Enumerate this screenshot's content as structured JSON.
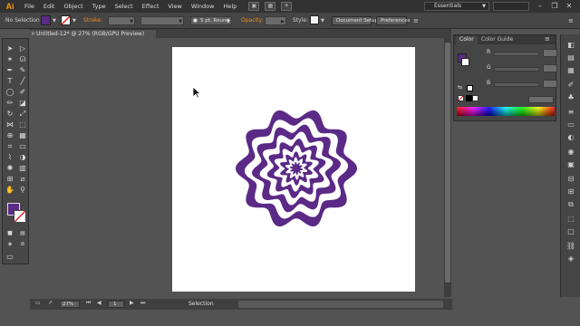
{
  "app": {
    "logo": "Ai",
    "workspace": "Essentials"
  },
  "menu": [
    "File",
    "Edit",
    "Object",
    "Type",
    "Select",
    "Effect",
    "View",
    "Window",
    "Help"
  ],
  "menu_icons": [
    "bridge-icon",
    "arrange-documents-icon",
    "gpu-icon"
  ],
  "control_bar": {
    "selection_label": "No Selection",
    "stroke_label": "Stroke:",
    "brush_label": "5 pt. Round",
    "opacity_label": "Opacity:",
    "style_label": "Style:",
    "document_setup": "Document Setup",
    "preferences": "Preferences",
    "fill_color": "#5b2a86"
  },
  "document": {
    "tab_title": "Untitled-12* @ 27% (RGB/GPU Preview)",
    "close": "×"
  },
  "canvas": {
    "artwork": "wavy-concentric-flower",
    "art_color": "#5b2a86"
  },
  "status": {
    "zoom": "27%",
    "artboard_number": "1",
    "tool": "Selection"
  },
  "color_panel": {
    "tabs": [
      "Color",
      "Color Guide"
    ],
    "channels": [
      "R",
      "G",
      "B"
    ],
    "fill_color": "#5b2a86"
  },
  "window_buttons": [
    "–",
    "❐",
    "✕"
  ]
}
